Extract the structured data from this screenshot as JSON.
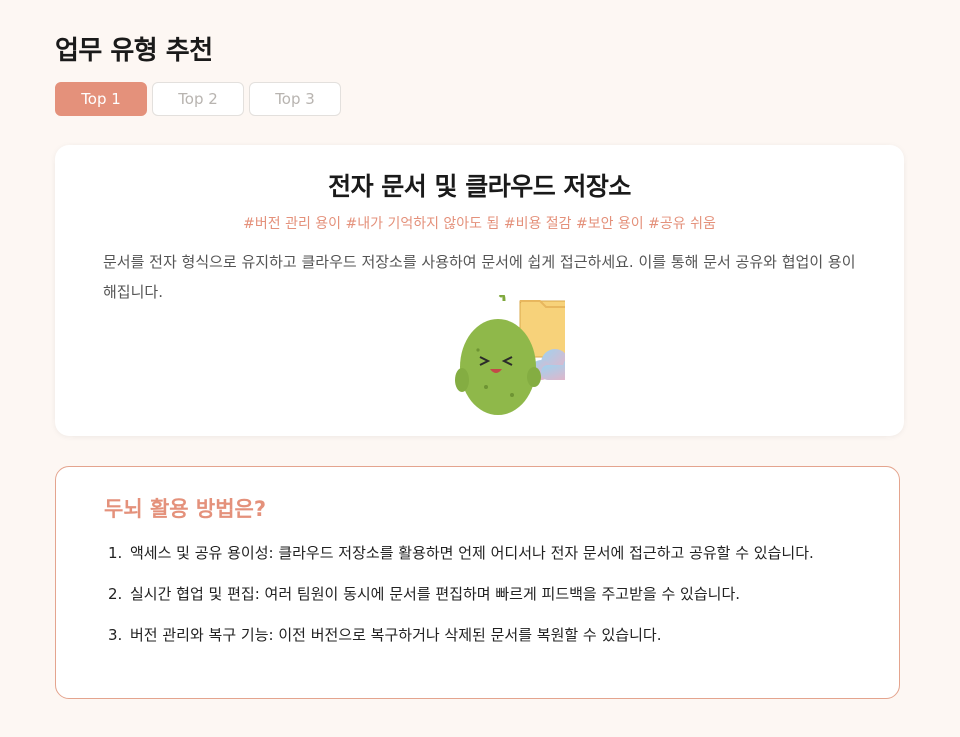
{
  "page": {
    "title": "업무 유형 추천"
  },
  "tabs": [
    {
      "label": "Top 1",
      "active": true
    },
    {
      "label": "Top 2",
      "active": false
    },
    {
      "label": "Top 3",
      "active": false
    }
  ],
  "recommendation": {
    "title": "전자 문서 및 클라우드 저장소",
    "tags": "#버전 관리 용이 #내가 기억하지 않아도 됨 #비용 절감 #보안 용이 #공유 쉬움",
    "description": "문서를 전자 형식으로 유지하고 클라우드 저장소를 사용하여 문서에 쉽게 접근하세요. 이를 통해 문서 공유와 협업이 용이해집니다.",
    "illustration_icons": [
      "mascot-icon",
      "folder-icon",
      "cloud-icon"
    ]
  },
  "tips": {
    "title": "두뇌 활용 방법은?",
    "items": [
      {
        "num": "1.",
        "text": "액세스 및 공유 용이성: 클라우드 저장소를 활용하면 언제 어디서나 전자 문서에 접근하고 공유할 수 있습니다."
      },
      {
        "num": "2.",
        "text": "실시간 협업 및 편집: 여러 팀원이 동시에 문서를 편집하며 빠르게 피드백을 주고받을 수 있습니다."
      },
      {
        "num": "3.",
        "text": "버전 관리와 복구 기능: 이전 버전으로 복구하거나 삭제된 문서를 복원할 수 있습니다."
      }
    ]
  },
  "colors": {
    "accent": "#e4917b",
    "background": "#fdf7f3",
    "mascot": "#8fb84a",
    "folder": "#f5c96a",
    "cloud_pink": "#f2aec0",
    "cloud_blue": "#9ed3f0"
  }
}
